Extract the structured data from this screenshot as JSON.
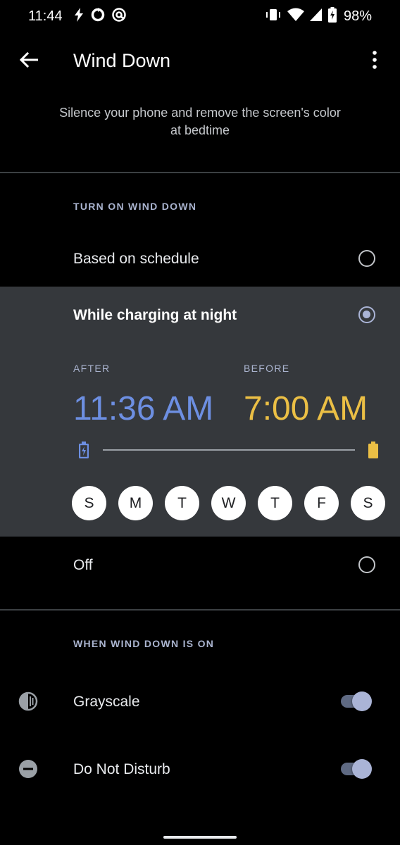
{
  "status_bar": {
    "time": "11:44",
    "left_icons": [
      "flash-icon",
      "sync-icon",
      "at-icon"
    ],
    "right_icons": [
      "vibrate-icon",
      "wifi-icon",
      "signal-icon",
      "battery-charging-icon"
    ],
    "battery": "98%"
  },
  "app_bar": {
    "title": "Wind Down",
    "back_icon": "back-arrow-icon",
    "menu_icon": "overflow-menu-icon"
  },
  "subtitle": "Silence your phone and remove the screen's color at bedtime",
  "turn_on_section": {
    "header": "TURN ON WIND DOWN",
    "options": [
      {
        "label": "Based on schedule",
        "selected": false
      },
      {
        "label": "While charging at night",
        "selected": true
      },
      {
        "label": "Off",
        "selected": false
      }
    ],
    "after_label": "AFTER",
    "after_time": "11:36 AM",
    "before_label": "BEFORE",
    "before_time": "7:00 AM",
    "days": [
      "S",
      "M",
      "T",
      "W",
      "T",
      "F",
      "S"
    ]
  },
  "when_on_section": {
    "header": "WHEN WIND DOWN IS ON",
    "items": [
      {
        "label": "Grayscale",
        "icon": "grayscale-icon",
        "enabled": true
      },
      {
        "label": "Do Not Disturb",
        "icon": "do-not-disturb-icon",
        "enabled": true
      }
    ]
  },
  "colors": {
    "accent": "#aab4d6",
    "after_time": "#6d8fe2",
    "before_time": "#ebbf45",
    "panel_bg": "#35383c"
  }
}
